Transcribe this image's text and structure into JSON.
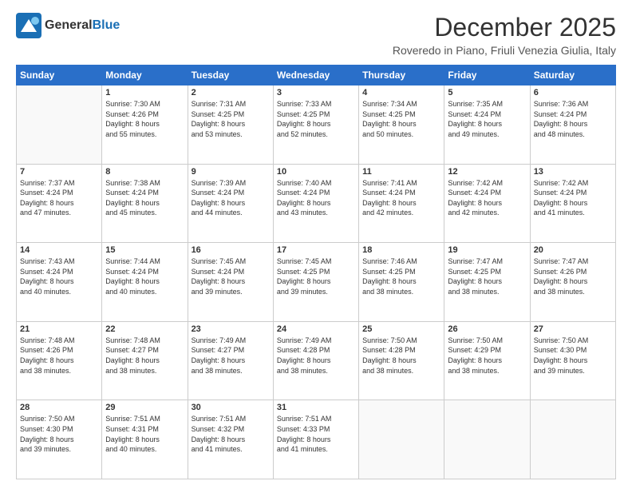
{
  "header": {
    "logo_general": "General",
    "logo_blue": "Blue",
    "main_title": "December 2025",
    "subtitle": "Roveredo in Piano, Friuli Venezia Giulia, Italy"
  },
  "calendar": {
    "days_of_week": [
      "Sunday",
      "Monday",
      "Tuesday",
      "Wednesday",
      "Thursday",
      "Friday",
      "Saturday"
    ],
    "weeks": [
      [
        {
          "day": "",
          "info": ""
        },
        {
          "day": "1",
          "info": "Sunrise: 7:30 AM\nSunset: 4:26 PM\nDaylight: 8 hours\nand 55 minutes."
        },
        {
          "day": "2",
          "info": "Sunrise: 7:31 AM\nSunset: 4:25 PM\nDaylight: 8 hours\nand 53 minutes."
        },
        {
          "day": "3",
          "info": "Sunrise: 7:33 AM\nSunset: 4:25 PM\nDaylight: 8 hours\nand 52 minutes."
        },
        {
          "day": "4",
          "info": "Sunrise: 7:34 AM\nSunset: 4:25 PM\nDaylight: 8 hours\nand 50 minutes."
        },
        {
          "day": "5",
          "info": "Sunrise: 7:35 AM\nSunset: 4:24 PM\nDaylight: 8 hours\nand 49 minutes."
        },
        {
          "day": "6",
          "info": "Sunrise: 7:36 AM\nSunset: 4:24 PM\nDaylight: 8 hours\nand 48 minutes."
        }
      ],
      [
        {
          "day": "7",
          "info": "Sunrise: 7:37 AM\nSunset: 4:24 PM\nDaylight: 8 hours\nand 47 minutes."
        },
        {
          "day": "8",
          "info": "Sunrise: 7:38 AM\nSunset: 4:24 PM\nDaylight: 8 hours\nand 45 minutes."
        },
        {
          "day": "9",
          "info": "Sunrise: 7:39 AM\nSunset: 4:24 PM\nDaylight: 8 hours\nand 44 minutes."
        },
        {
          "day": "10",
          "info": "Sunrise: 7:40 AM\nSunset: 4:24 PM\nDaylight: 8 hours\nand 43 minutes."
        },
        {
          "day": "11",
          "info": "Sunrise: 7:41 AM\nSunset: 4:24 PM\nDaylight: 8 hours\nand 42 minutes."
        },
        {
          "day": "12",
          "info": "Sunrise: 7:42 AM\nSunset: 4:24 PM\nDaylight: 8 hours\nand 42 minutes."
        },
        {
          "day": "13",
          "info": "Sunrise: 7:42 AM\nSunset: 4:24 PM\nDaylight: 8 hours\nand 41 minutes."
        }
      ],
      [
        {
          "day": "14",
          "info": "Sunrise: 7:43 AM\nSunset: 4:24 PM\nDaylight: 8 hours\nand 40 minutes."
        },
        {
          "day": "15",
          "info": "Sunrise: 7:44 AM\nSunset: 4:24 PM\nDaylight: 8 hours\nand 40 minutes."
        },
        {
          "day": "16",
          "info": "Sunrise: 7:45 AM\nSunset: 4:24 PM\nDaylight: 8 hours\nand 39 minutes."
        },
        {
          "day": "17",
          "info": "Sunrise: 7:45 AM\nSunset: 4:25 PM\nDaylight: 8 hours\nand 39 minutes."
        },
        {
          "day": "18",
          "info": "Sunrise: 7:46 AM\nSunset: 4:25 PM\nDaylight: 8 hours\nand 38 minutes."
        },
        {
          "day": "19",
          "info": "Sunrise: 7:47 AM\nSunset: 4:25 PM\nDaylight: 8 hours\nand 38 minutes."
        },
        {
          "day": "20",
          "info": "Sunrise: 7:47 AM\nSunset: 4:26 PM\nDaylight: 8 hours\nand 38 minutes."
        }
      ],
      [
        {
          "day": "21",
          "info": "Sunrise: 7:48 AM\nSunset: 4:26 PM\nDaylight: 8 hours\nand 38 minutes."
        },
        {
          "day": "22",
          "info": "Sunrise: 7:48 AM\nSunset: 4:27 PM\nDaylight: 8 hours\nand 38 minutes."
        },
        {
          "day": "23",
          "info": "Sunrise: 7:49 AM\nSunset: 4:27 PM\nDaylight: 8 hours\nand 38 minutes."
        },
        {
          "day": "24",
          "info": "Sunrise: 7:49 AM\nSunset: 4:28 PM\nDaylight: 8 hours\nand 38 minutes."
        },
        {
          "day": "25",
          "info": "Sunrise: 7:50 AM\nSunset: 4:28 PM\nDaylight: 8 hours\nand 38 minutes."
        },
        {
          "day": "26",
          "info": "Sunrise: 7:50 AM\nSunset: 4:29 PM\nDaylight: 8 hours\nand 38 minutes."
        },
        {
          "day": "27",
          "info": "Sunrise: 7:50 AM\nSunset: 4:30 PM\nDaylight: 8 hours\nand 39 minutes."
        }
      ],
      [
        {
          "day": "28",
          "info": "Sunrise: 7:50 AM\nSunset: 4:30 PM\nDaylight: 8 hours\nand 39 minutes."
        },
        {
          "day": "29",
          "info": "Sunrise: 7:51 AM\nSunset: 4:31 PM\nDaylight: 8 hours\nand 40 minutes."
        },
        {
          "day": "30",
          "info": "Sunrise: 7:51 AM\nSunset: 4:32 PM\nDaylight: 8 hours\nand 41 minutes."
        },
        {
          "day": "31",
          "info": "Sunrise: 7:51 AM\nSunset: 4:33 PM\nDaylight: 8 hours\nand 41 minutes."
        },
        {
          "day": "",
          "info": ""
        },
        {
          "day": "",
          "info": ""
        },
        {
          "day": "",
          "info": ""
        }
      ]
    ]
  }
}
